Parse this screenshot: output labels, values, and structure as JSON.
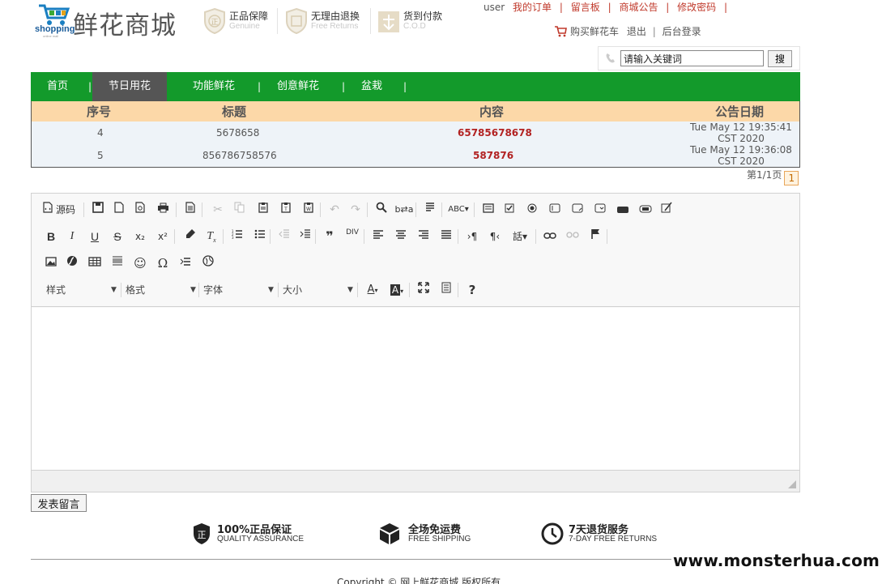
{
  "logo": {
    "word": "shopping",
    "sub": "online mall",
    "title": "鲜花商城"
  },
  "badges": [
    {
      "cn": "正品保障",
      "en": "Genuine"
    },
    {
      "cn": "无理由退换",
      "en": "Free Returns"
    },
    {
      "cn": "货到付款",
      "en": "C.O.D"
    }
  ],
  "toplinks": {
    "user": "user",
    "items": [
      "我的订单",
      "留言板",
      "商城公告",
      "修改密码"
    ],
    "sep": "|"
  },
  "cartline": {
    "cart": "购买鲜花车",
    "logout": "退出",
    "sep": "|",
    "admin": "后台登录"
  },
  "search": {
    "placeholder": "请输入关键词",
    "button": "搜"
  },
  "nav": {
    "items": [
      "首页",
      "节日用花",
      "功能鲜花",
      "创意鲜花",
      "盆栽"
    ],
    "sep": "|",
    "active": 1
  },
  "table": {
    "headers": [
      "序号",
      "标题",
      "内容",
      "公告日期"
    ],
    "rows": [
      {
        "id": "4",
        "title": "5678658",
        "content": "65785678678",
        "date": "Tue May 12 19:35:41 CST 2020"
      },
      {
        "id": "5",
        "title": "856786758576",
        "content": "587876",
        "date": "Tue May 12 19:36:08 CST 2020"
      }
    ]
  },
  "pager": {
    "text": "第1/1页",
    "current": "1"
  },
  "editor": {
    "source_label": "源码",
    "combos": {
      "style": "样式",
      "format": "格式",
      "font": "字体",
      "size": "大小"
    }
  },
  "submit_label": "发表留言",
  "footer": {
    "items": [
      {
        "cn": "100%正品保证",
        "en": "QUALITY ASSURANCE",
        "icon": "正"
      },
      {
        "cn": "全场免运费",
        "en": "FREE SHIPPING"
      },
      {
        "cn": "7天退货服务",
        "en": "7-DAY FREE RETURNS"
      }
    ],
    "copyright": "Copyright © 网上鲜花商城 版权所有"
  },
  "watermark": "www.monsterhua.com",
  "colors": {
    "nav_green": "#139a2b",
    "nav_active": "#555555",
    "table_head": "#fcd8a8",
    "link_red": "#c0392b"
  }
}
